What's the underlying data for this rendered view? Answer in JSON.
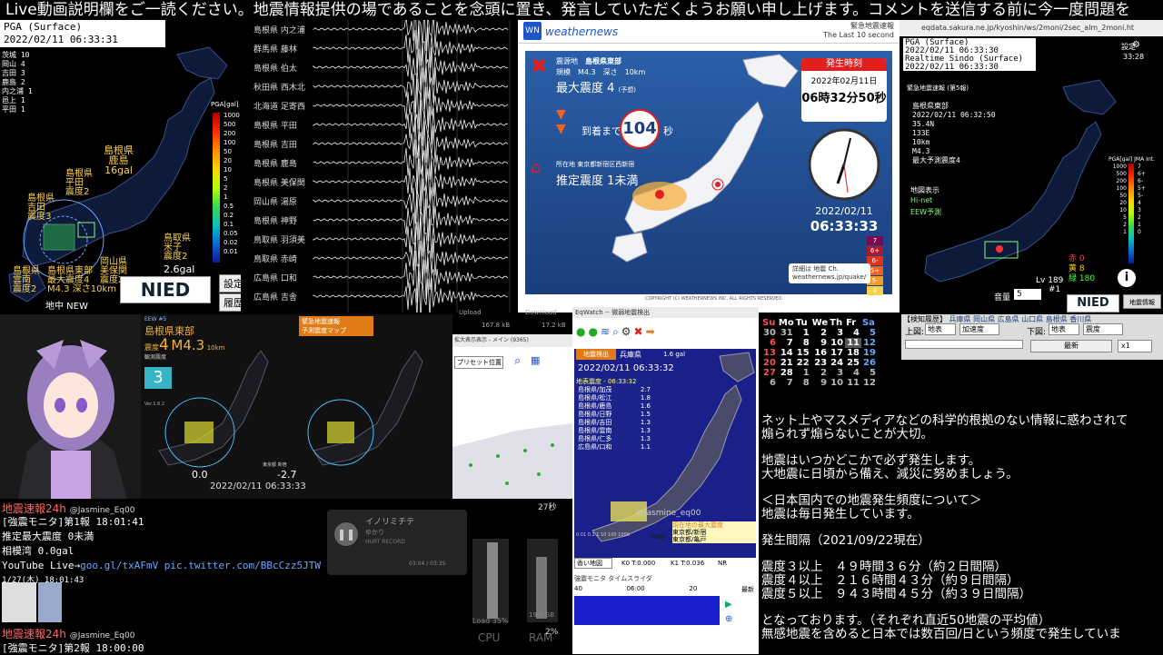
{
  "marquee": "Live動画説明欄をご一読ください。地震情報提供の場であることを念頭に置き、発言していただくようお願い申し上げます。コメントを送信する前に今一度問題を",
  "panelA": {
    "pga_label": "PGA (Surface)",
    "datetime": "2022/02/11 06:33:31",
    "list": [
      "茨城 10",
      "岡山 4",
      "吉田 3",
      "鹿島 2",
      "内之浦 1",
      "邑上 1",
      "平田 1"
    ],
    "scale_title": "PGA[gal]",
    "scale_ticks": [
      "1000",
      "500",
      "200",
      "100",
      "50",
      "20",
      "10",
      "5",
      "2",
      "1",
      "0.5",
      "0.2",
      "0.1",
      "0.05",
      "0.02",
      "0.01"
    ],
    "callouts": [
      "島根県\n鹿島\n16gal",
      "島根県\n平田\n震度2",
      "島根県\n吉田\n震度3",
      "鳥取県\n米子\n震度2",
      "島根県\n雲南\n震度2",
      "岡山県\n美保関\n震度2",
      "島根県東部\n最大震度4\nM4.3 深さ10km"
    ],
    "gal_value": "2.6gal",
    "lower_label": "地中 NEW",
    "btn_settings": "設定",
    "btn_history": "履歴",
    "nied": "NIED"
  },
  "panelB": {
    "stations": [
      "島根県 内之浦",
      "群馬県 藤林",
      "島根県 伯太",
      "秋田県 西木北",
      "北海道 足寄西",
      "島根県 平田",
      "島根県 吉田",
      "島根県 鹿島",
      "島根県 美保関",
      "岡山県 湯原",
      "島根県 神野",
      "鳥取県 羽須美",
      "鳥取県 赤崎",
      "広島県 口和",
      "広島県 吉舎"
    ]
  },
  "panelC": {
    "brand": "weathernews",
    "header_right": "緊急地震速報\nThe Last 10 second",
    "epicenter_label": "震源地",
    "epicenter": "島根県東部",
    "scale_label": "規模",
    "magnitude": "M4.3",
    "depth_label": "深さ",
    "depth": "10km",
    "max_int_label": "最大震度",
    "max_int": "4",
    "predicted": "(予想)",
    "arrival_label": "到着まで",
    "arrival": "104",
    "arrival_unit": "秒",
    "place_label": "所在地",
    "place": "東京都新宿区西新宿",
    "est_label": "推定震度",
    "est": "1未満",
    "occ_label": "発生時刻",
    "occ_date": "2022年02月11日",
    "occ_time": "06時32分50秒",
    "clock_date": "2022/02/11",
    "clock_time": "06:33:33",
    "legend": [
      "7",
      "6+",
      "6-",
      "5+",
      "5-",
      "4"
    ],
    "legend_colors": [
      "#7a0a50",
      "#ad1a2e",
      "#e0321d",
      "#f2621d",
      "#f59a2c",
      "#f7d24d"
    ],
    "ad": "詳細は 地震 Ch.",
    "ad_url": "weathernews.jp/quake/",
    "copyright": "COPYRIGHT (C) WEATHERNEWS INC. ALL RIGHTS RESERVED."
  },
  "panelD": {
    "url": "eqdata.sakura.ne.jp/kyoshin/ws/2moni/2sec_alm_2moni.ht",
    "pga_label": "PGA (Surface)",
    "pga_time": "2022/02/11 06:33:30",
    "rt_label": "Realtime Sindo (Surface)",
    "rt_time": "2022/02/11 06:33:30",
    "settings": "設定",
    "clock": "33:28",
    "eew_title": "緊急地震速報 (第5報)",
    "eew_lines": [
      "島根県東部",
      "2022/02/11 06:32:50",
      "35.4N",
      "133E",
      "10km",
      "M4.3",
      "最大予測震度4"
    ],
    "legend_title": "PGA[gal]",
    "legend_right": "JMA Int.",
    "legend_ticks": [
      "1000",
      "500",
      "200",
      "100",
      "50",
      "20",
      "10",
      "5",
      "2",
      "1"
    ],
    "legend_int": [
      "7",
      "6+",
      "6-",
      "5+",
      "5-",
      "4",
      "3",
      "2",
      "1",
      "0"
    ],
    "layer_label": "地図表示",
    "layer_hinet": "Hi-net",
    "layer_eew": "EEW予測",
    "red_label": "赤",
    "red_val": "0",
    "yellow_label": "黄",
    "yellow_val": "8",
    "green_label": "緑",
    "green_val": "180",
    "lv": "Lv 189",
    "vol_label": "音量",
    "vol_val": "5",
    "nied": "NIED",
    "eew_btn": "地震情報",
    "num_label": "#1"
  },
  "panelF": {
    "tag": "EEW #5",
    "region": "島根県東部",
    "int_label": "震度",
    "int": "4",
    "mag": "M4.3",
    "depth": "10km",
    "obs_label": "観測震度",
    "obs_val": "3",
    "alert_title": "緊急地震速報",
    "alert_sub": "予測震度マップ",
    "ver": "Ver.1.6.2",
    "intensity": "0.0",
    "int2": "-2.7",
    "loc": "東京都 新宿",
    "datetime": "2022/02/11  06:33:33",
    "upload_label": "Upload",
    "upload": "167.8 kB",
    "download_label": "Download",
    "download": "17.2 kB"
  },
  "panelG": {
    "title": "拡大表示表示 - メイン (9365)",
    "preset": "プリセット位置"
  },
  "panelH": {
    "title": "EqWatch -- 微弱地震検出",
    "banner": "地震検出",
    "pref": "兵庫県",
    "gal": "1.6 gal",
    "datetime": "2022/02/11 06:33:32",
    "list_title": "地表震度 - 06:33:32",
    "rows": [
      [
        "島根県/加茂",
        "2.7"
      ],
      [
        "島根県/松江",
        "1.8"
      ],
      [
        "島根県/鹿島",
        "1.6"
      ],
      [
        "島根県/日野",
        "1.5"
      ],
      [
        "島根県/吉田",
        "1.3"
      ],
      [
        "島根県/雲南",
        "1.3"
      ],
      [
        "島根県/仁多",
        "1.3"
      ],
      [
        "広島県/口和",
        "1.1"
      ]
    ],
    "watermark": "@jasmine_eq00",
    "current": "現在地の最大震度",
    "current_rows": [
      "東京都/新宿",
      "東京都/亀戸"
    ],
    "k0_label": "K0",
    "k0": "T:0.000",
    "k1_label": "K1",
    "k1": "T:0.036",
    "nr": "NR",
    "drop": "香い地図",
    "timeline_title": "強震モニタ タイムスライダ",
    "tl_labels": [
      "40",
      "06:00",
      "20",
      "最新"
    ],
    "scale_labels": [
      "0.01",
      "0.1",
      "1",
      "10",
      "100",
      "1000"
    ],
    "nied": "NIED"
  },
  "calendar": {
    "head": [
      "Su",
      "Mo",
      "Tu",
      "We",
      "Th",
      "Fr",
      "Sa"
    ],
    "rows": [
      [
        "30",
        "31",
        "1",
        "2",
        "3",
        "4",
        "5"
      ],
      [
        "6",
        "7",
        "8",
        "9",
        "10",
        "11",
        "12"
      ],
      [
        "13",
        "14",
        "15",
        "16",
        "17",
        "18",
        "19"
      ],
      [
        "20",
        "21",
        "22",
        "23",
        "24",
        "25",
        "26"
      ],
      [
        "27",
        "28",
        "1",
        "2",
        "3",
        "4",
        "5"
      ],
      [
        "6",
        "7",
        "8",
        "9",
        "10",
        "11",
        "12"
      ]
    ]
  },
  "panelJ": {
    "title": "【検知履歴】",
    "tags": [
      "兵庫県",
      "岡山県",
      "広島県",
      "山口県",
      "島根県",
      "香川県"
    ],
    "upper_label": "上図:",
    "upper": "地表",
    "accel": "加速度",
    "lower_label": "下図:",
    "lower": "地表",
    "lower2": "震度",
    "latest": "最新",
    "zoom": "x1"
  },
  "ticker": {
    "title1": "地震速報24h",
    "user1": "@Jasmine_Eq00",
    "seconds": "27秒",
    "line1": "[強震モニタ]第1報 18:01:41",
    "line2": "推定最大震度 0未満",
    "line3": "相模湾 0.0gal",
    "yt_label": "YouTube Live→",
    "yt_link": "goo.gl/txAFmV pic.twitter.com/BBcCzz5JTW",
    "date": "1/27(木) 18:01:43",
    "title2": "地震速報24h",
    "user2": "@Jasmine_Eq00",
    "line4": "[強震モニタ]第2報 18:00:00",
    "media_title": "イノリミチテ",
    "media_artist": "ゆかり",
    "media_sub": "HURT RECORD",
    "media_time": "03:04 / 03:35",
    "load": "Load 35%",
    "cpu": "CPU",
    "ram": "RAM",
    "ram_val": "19.0 GB",
    "pct": "2%"
  },
  "notice": {
    "lines": [
      "ネット上やマスメディアなどの科学的根拠のない情報に惑わされて",
      "煽られず煽らないことが大切。",
      "",
      "地震はいつかどこかで必ず発生します。",
      "大地震に日頃から備え、減災に努めましょう。",
      "",
      "＜日本国内での地震発生頻度について＞",
      "地震は毎日発生しています。",
      "",
      "発生間隔（2021/09/22現在）",
      "",
      "震度３以上　４９時間３６分（約２日間隔）",
      "震度４以上　２１６時間４３分（約９日間隔）",
      "震度５以上　９４３時間４５分（約３９日間隔）",
      "",
      "となっております。（それぞれ直近50地震の平均値）",
      "無感地震を含めると日本では数百回/日という頻度で発生していま"
    ]
  }
}
